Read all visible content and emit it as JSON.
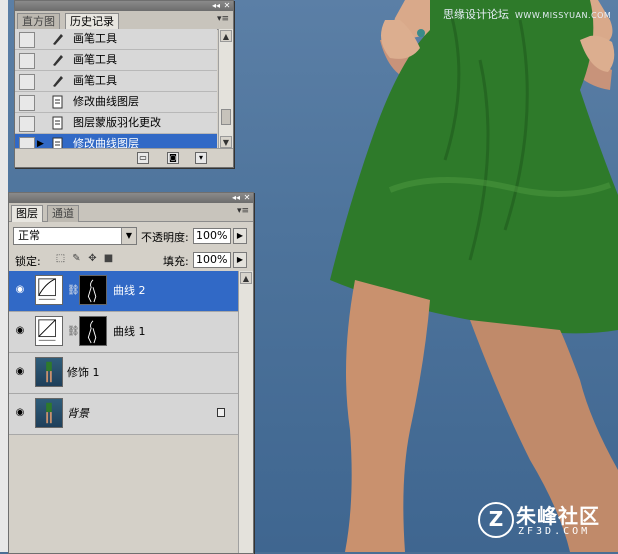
{
  "watermark": {
    "text": "思缘设计论坛",
    "url": "WWW.MISSYUAN.COM"
  },
  "logo": {
    "name": "朱峰社区",
    "domain": "ZF3D.COM",
    "mark": "Z"
  },
  "history_panel": {
    "tabs": [
      {
        "label": "直方图",
        "active": false
      },
      {
        "label": "历史记录",
        "active": true
      }
    ],
    "rows": [
      {
        "label": "画笔工具",
        "icon": "brush-icon",
        "selected": false
      },
      {
        "label": "画笔工具",
        "icon": "brush-icon",
        "selected": false
      },
      {
        "label": "画笔工具",
        "icon": "brush-icon",
        "selected": false
      },
      {
        "label": "修改曲线图层",
        "icon": "document-icon",
        "selected": false
      },
      {
        "label": "图层蒙版羽化更改",
        "icon": "document-icon",
        "selected": false
      },
      {
        "label": "修改曲线图层",
        "icon": "document-icon",
        "selected": true
      }
    ]
  },
  "layers_panel": {
    "tabs": [
      {
        "label": "图层",
        "active": true
      },
      {
        "label": "通道",
        "active": false
      }
    ],
    "blend_mode": "正常",
    "opacity_label": "不透明度:",
    "opacity_value": "100%",
    "lock_label": "锁定:",
    "fill_label": "填充:",
    "fill_value": "100%",
    "layers": [
      {
        "name": "曲线 2",
        "type": "curves",
        "selected": true,
        "visible": true
      },
      {
        "name": "曲线 1",
        "type": "curves",
        "selected": false,
        "visible": true
      },
      {
        "name": "修饰 1",
        "type": "image",
        "selected": false,
        "visible": true
      },
      {
        "name": "背景",
        "type": "background",
        "selected": false,
        "visible": true,
        "locked": true
      }
    ]
  },
  "colors": {
    "selection": "#3169c6",
    "panel": "#d4d0c8",
    "photo_background": "#4e749c",
    "dress": "#2e7a2a"
  }
}
